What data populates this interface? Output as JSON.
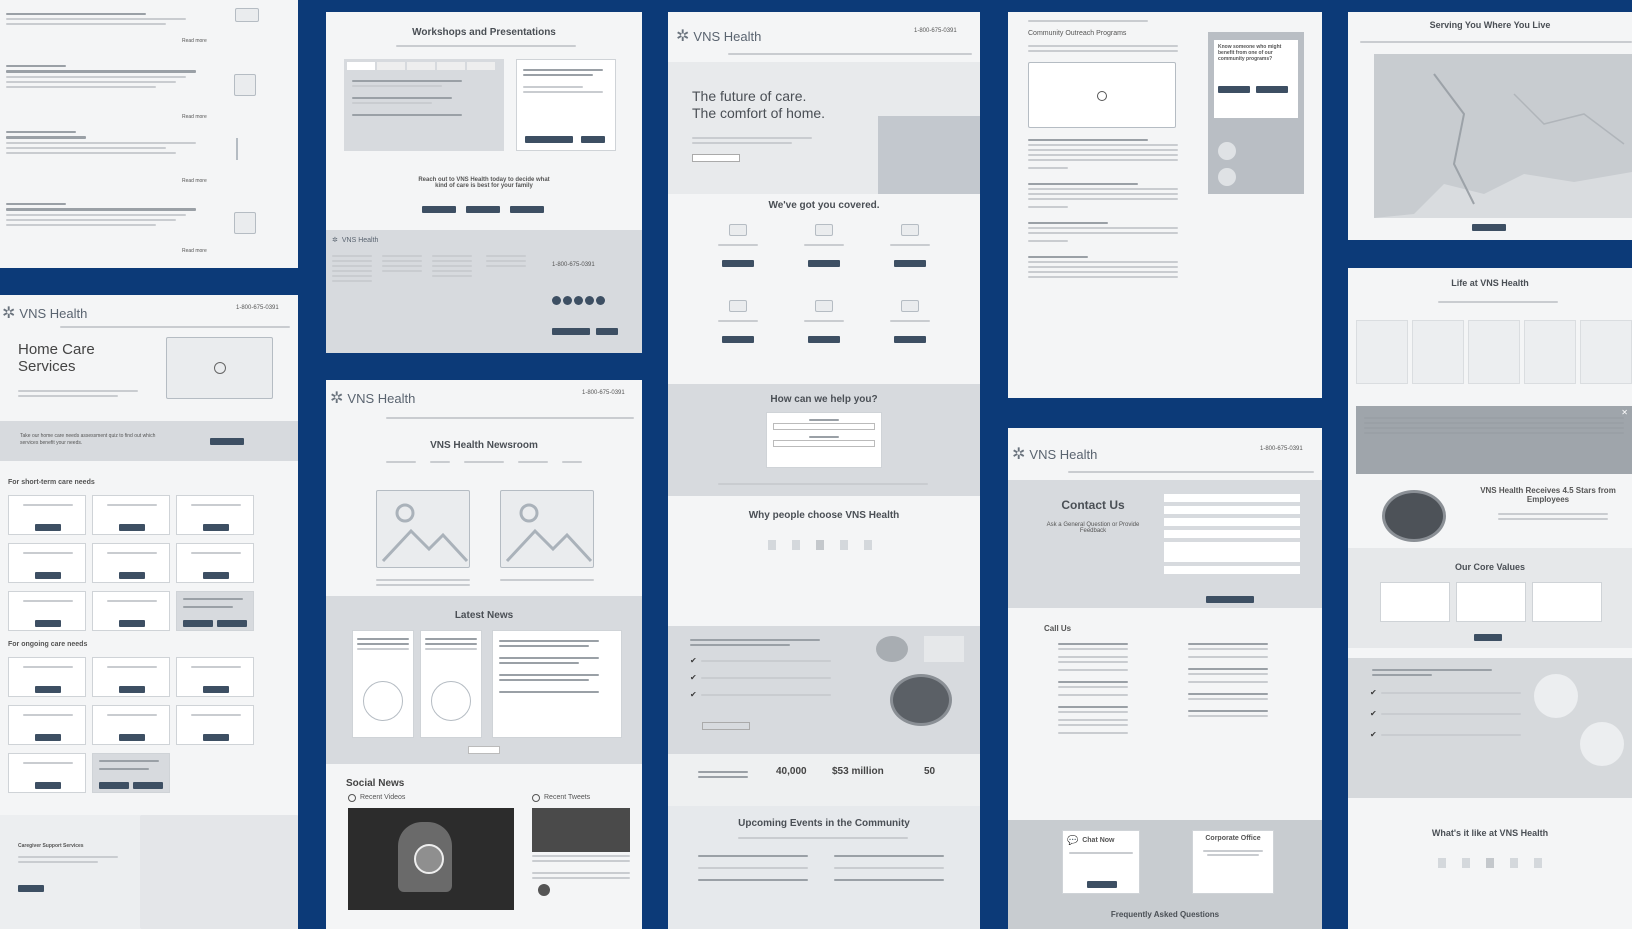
{
  "brand": {
    "name": "VNS Health",
    "phone": "1-800-675-0391"
  },
  "panel_events": {
    "more_label": "Read more"
  },
  "panel_workshops": {
    "title": "Workshops and Presentations",
    "cta": "Reach out to VNS Health today to decide what kind of care is best for your family"
  },
  "panel_home_care": {
    "title_line1": "Home Care",
    "title_line2": "Services",
    "banner_text": "Take our home care needs assessment quiz to find out which services benefit your needs.",
    "section1": "For short-term care needs",
    "section2": "For ongoing care needs",
    "section3": "Caregiver Support Services"
  },
  "panel_newsroom": {
    "title": "VNS Health Newsroom",
    "latest": "Latest News",
    "social": "Social News",
    "videos": "Recent Videos",
    "tweets": "Recent Tweets"
  },
  "panel_home": {
    "hero_line1": "The future of care.",
    "hero_line2": "The comfort of home.",
    "covered": "We've got you covered.",
    "help": "How can we help you?",
    "why": "Why people choose VNS Health",
    "stat1": "40,000",
    "stat2": "$53 million",
    "stat3": "50",
    "events": "Upcoming Events in the Community"
  },
  "panel_outreach": {
    "title": "Community Outreach Programs",
    "sidebar_q": "Know someone who might benefit from one of our community programs?"
  },
  "panel_contact": {
    "title": "Contact Us",
    "subtitle": "Ask a General Question or Provide Feedback",
    "call_us": "Call Us",
    "chat_now": "Chat Now",
    "corporate": "Corporate Office",
    "faq": "Frequently Asked Questions"
  },
  "panel_serving": {
    "title": "Serving You Where You Live"
  },
  "panel_life": {
    "title": "Life at VNS Health",
    "award": "VNS Health Receives 4.5 Stars from Employees",
    "core": "Our Core Values",
    "what": "What's it like at VNS Health"
  }
}
